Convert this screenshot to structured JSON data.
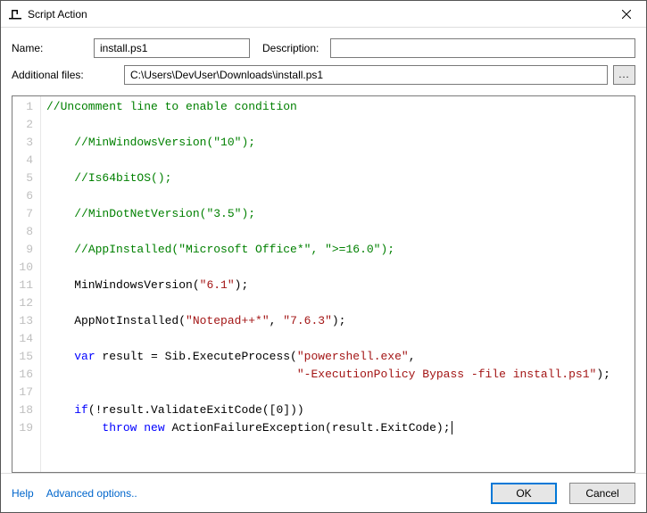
{
  "window": {
    "title": "Script Action"
  },
  "form": {
    "name_label": "Name:",
    "name_value": "install.ps1",
    "desc_label": "Description:",
    "desc_value": "",
    "files_label": "Additional files:",
    "files_value": "C:\\Users\\DevUser\\Downloads\\install.ps1",
    "browse_label": "..."
  },
  "code": {
    "indent": "    ",
    "lines": [
      {
        "n": 1,
        "tokens": [
          {
            "t": "//Uncomment line to enable condition",
            "c": "comment"
          }
        ]
      },
      {
        "n": 2,
        "tokens": []
      },
      {
        "n": 3,
        "tokens": [
          {
            "t": "    ",
            "c": "plain"
          },
          {
            "t": "//MinWindowsVersion(\"10\");",
            "c": "comment"
          }
        ]
      },
      {
        "n": 4,
        "tokens": []
      },
      {
        "n": 5,
        "tokens": [
          {
            "t": "    ",
            "c": "plain"
          },
          {
            "t": "//Is64bitOS();",
            "c": "comment"
          }
        ]
      },
      {
        "n": 6,
        "tokens": []
      },
      {
        "n": 7,
        "tokens": [
          {
            "t": "    ",
            "c": "plain"
          },
          {
            "t": "//MinDotNetVersion(\"3.5\");",
            "c": "comment"
          }
        ]
      },
      {
        "n": 8,
        "tokens": []
      },
      {
        "n": 9,
        "tokens": [
          {
            "t": "    ",
            "c": "plain"
          },
          {
            "t": "//AppInstalled(\"Microsoft Office*\", \">=16.0\");",
            "c": "comment"
          }
        ]
      },
      {
        "n": 10,
        "tokens": []
      },
      {
        "n": 11,
        "tokens": [
          {
            "t": "    ",
            "c": "plain"
          },
          {
            "t": "MinWindowsVersion(",
            "c": "plain"
          },
          {
            "t": "\"6.1\"",
            "c": "string"
          },
          {
            "t": ");",
            "c": "plain"
          }
        ]
      },
      {
        "n": 12,
        "tokens": []
      },
      {
        "n": 13,
        "tokens": [
          {
            "t": "    ",
            "c": "plain"
          },
          {
            "t": "AppNotInstalled(",
            "c": "plain"
          },
          {
            "t": "\"Notepad++*\"",
            "c": "string"
          },
          {
            "t": ", ",
            "c": "plain"
          },
          {
            "t": "\"7.6.3\"",
            "c": "string"
          },
          {
            "t": ");",
            "c": "plain"
          }
        ]
      },
      {
        "n": 14,
        "tokens": []
      },
      {
        "n": 15,
        "tokens": [
          {
            "t": "    ",
            "c": "plain"
          },
          {
            "t": "var",
            "c": "keyword"
          },
          {
            "t": " result = Sib.ExecuteProcess(",
            "c": "plain"
          },
          {
            "t": "\"powershell.exe\"",
            "c": "string"
          },
          {
            "t": ",",
            "c": "plain"
          }
        ]
      },
      {
        "n": 16,
        "tokens": [
          {
            "t": "                                    ",
            "c": "plain"
          },
          {
            "t": "\"-ExecutionPolicy Bypass -file install.ps1\"",
            "c": "string"
          },
          {
            "t": ");",
            "c": "plain"
          }
        ]
      },
      {
        "n": 17,
        "tokens": []
      },
      {
        "n": 18,
        "tokens": [
          {
            "t": "    ",
            "c": "plain"
          },
          {
            "t": "if",
            "c": "keyword"
          },
          {
            "t": "(!result.ValidateExitCode([",
            "c": "plain"
          },
          {
            "t": "0",
            "c": "number"
          },
          {
            "t": "]))",
            "c": "plain"
          }
        ]
      },
      {
        "n": 19,
        "tokens": [
          {
            "t": "        ",
            "c": "plain"
          },
          {
            "t": "throw",
            "c": "keyword"
          },
          {
            "t": " ",
            "c": "plain"
          },
          {
            "t": "new",
            "c": "keyword"
          },
          {
            "t": " ActionFailureException(result.ExitCode);",
            "c": "plain"
          }
        ],
        "caret": true
      }
    ]
  },
  "footer": {
    "help": "Help",
    "advanced": "Advanced options..",
    "ok": "OK",
    "cancel": "Cancel"
  }
}
